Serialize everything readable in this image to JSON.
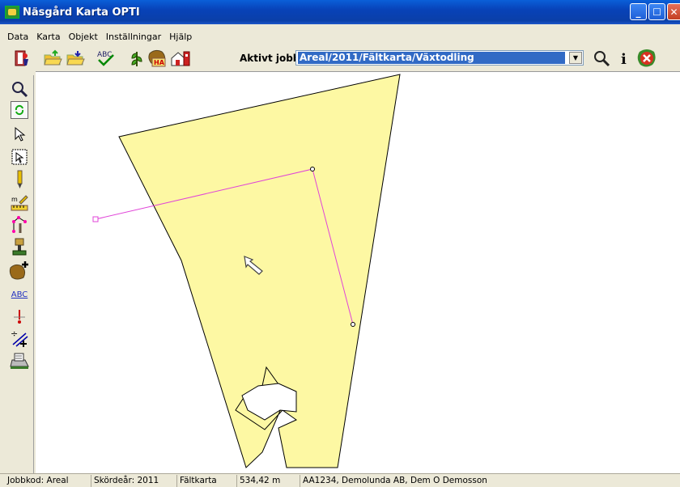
{
  "window": {
    "title": "Näsgård Karta OPTI"
  },
  "menu": [
    "Data",
    "Karta",
    "Objekt",
    "Inställningar",
    "Hjälp"
  ],
  "toolbar": {
    "job_label": "Aktivt jobb",
    "job_value": "Areal/2011/Fältkarta/Växtodling",
    "icons": [
      "exit-icon",
      "open-folder-icon",
      "save-folder-icon",
      "spellcheck-icon",
      "crop-icon",
      "area-ha-icon",
      "farm-building-icon",
      "zoom-icon",
      "info-icon",
      "close-red-icon"
    ]
  },
  "palette": {
    "tools": [
      "zoom-icon",
      "refresh-icon",
      "select-arrow-icon",
      "select-box-icon",
      "pencil-icon",
      "measure-icon",
      "polygon-edit-icon",
      "stamp-icon",
      "add-area-icon",
      "text-label-icon",
      "pin-icon",
      "split-line-icon",
      "printer-icon"
    ],
    "text_label": "ABC"
  },
  "map": {
    "field_color": "#fdf8a3",
    "measure_line_color": "#e044d8"
  },
  "statusbar": {
    "job_code": "Jobbkod: Areal",
    "harvest_year": "Skördeår: 2011",
    "layer": "Fältkarta",
    "measure": "534,42 m",
    "owner": "AA1234, Demolunda AB, Dem O Demosson"
  }
}
